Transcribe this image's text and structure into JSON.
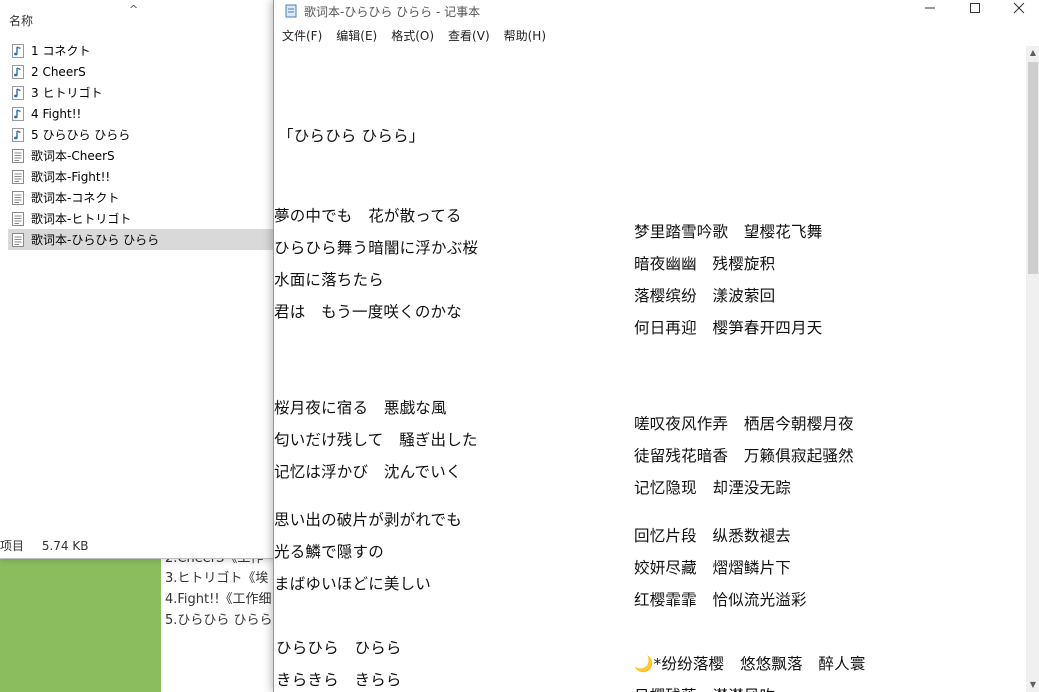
{
  "background_window": {
    "lines": [
      "2.CheerS《工作",
      "3.ヒトリゴト《埃",
      "4.Fight!!《工作细",
      "5.ひらひら ひらら"
    ]
  },
  "explorer": {
    "column_name": "名称",
    "items": [
      {
        "label": "1 コネクト",
        "type": "audio"
      },
      {
        "label": "2 CheerS",
        "type": "audio"
      },
      {
        "label": "3 ヒトリゴト",
        "type": "audio"
      },
      {
        "label": "4 Fight!!",
        "type": "audio"
      },
      {
        "label": "5 ひらひら ひらら",
        "type": "audio"
      },
      {
        "label": "歌词本-CheerS",
        "type": "text"
      },
      {
        "label": "歌词本-Fight!!",
        "type": "text"
      },
      {
        "label": "歌词本-コネクト",
        "type": "text"
      },
      {
        "label": "歌词本-ヒトリゴト",
        "type": "text"
      },
      {
        "label": "歌词本-ひらひら ひらら",
        "type": "text",
        "selected": true
      }
    ],
    "status": {
      "items_label": "项目",
      "size": "5.74 KB"
    }
  },
  "notepad": {
    "title": "歌词本-ひらひら ひらら - 记事本",
    "menus": [
      "文件(F)",
      "编辑(E)",
      "格式(O)",
      "查看(V)",
      "帮助(H)"
    ],
    "song_title": "「ひらひら ひらら」",
    "japanese_lines": [
      "夢の中でも　花が散ってる",
      "ひらひら舞う暗闇に浮かぶ桜",
      "水面に落ちたら",
      "君は　もう一度咲くのかな",
      "桜月夜に宿る　悪戯な風",
      "匂いだけ残して　騒ぎ出した",
      "记忆は浮かび　沈んでいく",
      "思い出の破片が剥がれでも",
      "光る鱗で隠すの",
      "まばゆいほどに美しい",
      "ひらひら　ひらら",
      "きらきら　きらら"
    ],
    "chinese_lines": [
      "梦里踏雪吟歌　望樱花飞舞",
      "暗夜幽幽　残樱旋积",
      "落樱缤纷　漾波萦回",
      "何日再迎　樱笋春开四月天",
      "嗟叹夜风作弄　栖居今朝樱月夜",
      "徒留残花暗香　万籁俱寂起骚然",
      "记忆隐现　却湮没无踪",
      "回忆片段　纵悉数褪去",
      "姣妍尽藏　熠熠鳞片下",
      "红樱霏霏　恰似流光溢彩",
      "🌙*纷纷落樱　悠悠飘落　醉人寰"
    ]
  },
  "colors": {
    "green": "#8bbd5e",
    "selection": "#d9d9d9",
    "audio_icon": "#2f6fb8"
  }
}
